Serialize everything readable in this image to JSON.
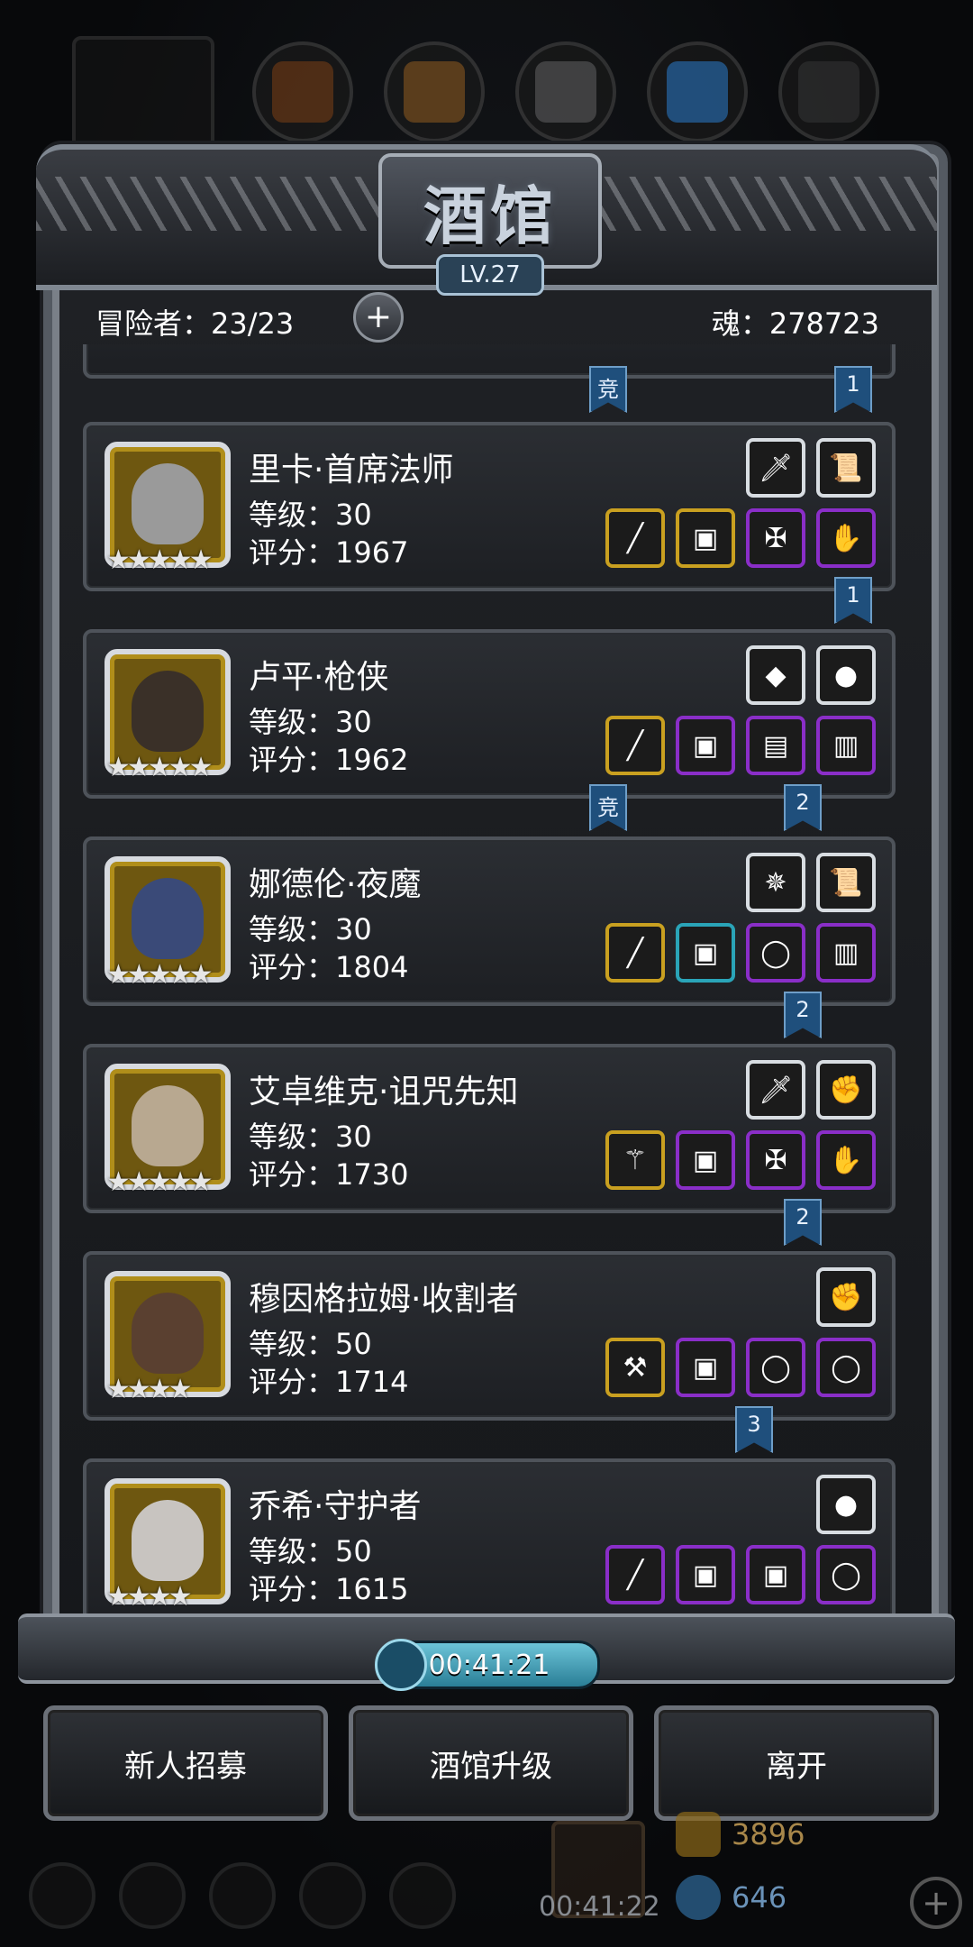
{
  "panel": {
    "title": "酒馆",
    "level": "LV.27",
    "adventurers_label": "冒险者：23/23",
    "soul_label": "魂：278723"
  },
  "top_ribbons": [
    {
      "label": "竞"
    },
    {
      "label": "1"
    }
  ],
  "heroes": [
    {
      "name": "里卡·首席法师",
      "level": "等级：30",
      "score": "评分：1967",
      "stars": "★★★★★",
      "portrait_color": "#9a9a9a",
      "top_items": [
        {
          "icon": "dagger-icon",
          "glyph": "🗡",
          "rarity": "white"
        },
        {
          "icon": "scroll-icon",
          "glyph": "📜",
          "rarity": "white"
        }
      ],
      "bottom_items": [
        {
          "icon": "staff-icon",
          "glyph": "╱",
          "rarity": "gold"
        },
        {
          "icon": "armor-icon",
          "glyph": "▣",
          "rarity": "gold"
        },
        {
          "icon": "amulet-icon",
          "glyph": "✠",
          "rarity": "purple"
        },
        {
          "icon": "gauntlet-icon",
          "glyph": "✋",
          "rarity": "purple"
        }
      ],
      "ribbons": [
        {
          "label": "1"
        }
      ]
    },
    {
      "name": "卢平·枪侠",
      "level": "等级：30",
      "score": "评分：1962",
      "stars": "★★★★★",
      "portrait_color": "#3a3028",
      "top_items": [
        {
          "icon": "crystal-icon",
          "glyph": "◆",
          "rarity": "white"
        },
        {
          "icon": "gem-icon",
          "glyph": "●",
          "rarity": "white"
        }
      ],
      "bottom_items": [
        {
          "icon": "spear-icon",
          "glyph": "╱",
          "rarity": "gold"
        },
        {
          "icon": "armor-icon",
          "glyph": "▣",
          "rarity": "purple"
        },
        {
          "icon": "plank-icon",
          "glyph": "▤",
          "rarity": "purple"
        },
        {
          "icon": "cloak-icon",
          "glyph": "▥",
          "rarity": "purple"
        }
      ],
      "ribbons": [
        {
          "label": "竞"
        },
        {
          "label": "2"
        }
      ]
    },
    {
      "name": "娜德伦·夜魔",
      "level": "等级：30",
      "score": "评分：1804",
      "stars": "★★★★★",
      "portrait_color": "#3a4a78",
      "top_items": [
        {
          "icon": "emblem-icon",
          "glyph": "✵",
          "rarity": "white"
        },
        {
          "icon": "scroll-icon",
          "glyph": "📜",
          "rarity": "white"
        }
      ],
      "bottom_items": [
        {
          "icon": "spear-icon",
          "glyph": "╱",
          "rarity": "gold"
        },
        {
          "icon": "armor-icon",
          "glyph": "▣",
          "rarity": "cyan"
        },
        {
          "icon": "ring-icon",
          "glyph": "◯",
          "rarity": "purple"
        },
        {
          "icon": "cloak-icon",
          "glyph": "▥",
          "rarity": "purple"
        }
      ],
      "ribbons": [
        {
          "label": "2"
        }
      ]
    },
    {
      "name": "艾卓维克·诅咒先知",
      "level": "等级：30",
      "score": "评分：1730",
      "stars": "★★★★★",
      "portrait_color": "#b8a890",
      "top_items": [
        {
          "icon": "dagger-icon",
          "glyph": "🗡",
          "rarity": "white"
        },
        {
          "icon": "glove-icon",
          "glyph": "✊",
          "rarity": "white"
        }
      ],
      "bottom_items": [
        {
          "icon": "staff-icon",
          "glyph": "⚚",
          "rarity": "gold"
        },
        {
          "icon": "armor-icon",
          "glyph": "▣",
          "rarity": "purple"
        },
        {
          "icon": "amulet-icon",
          "glyph": "✠",
          "rarity": "purple"
        },
        {
          "icon": "gauntlet-icon",
          "glyph": "✋",
          "rarity": "purple"
        }
      ],
      "ribbons": [
        {
          "label": "2"
        }
      ]
    },
    {
      "name": "穆因格拉姆·收割者",
      "level": "等级：50",
      "score": "评分：1714",
      "stars": "★★★★",
      "portrait_color": "#5a4030",
      "top_items": [
        {
          "icon": "glove-icon",
          "glyph": "✊",
          "rarity": "white"
        }
      ],
      "bottom_items": [
        {
          "icon": "axe-icon",
          "glyph": "⚒",
          "rarity": "gold"
        },
        {
          "icon": "armor-icon",
          "glyph": "▣",
          "rarity": "purple"
        },
        {
          "icon": "ring-icon",
          "glyph": "◯",
          "rarity": "purple"
        },
        {
          "icon": "ring-icon",
          "glyph": "◯",
          "rarity": "purple"
        }
      ],
      "ribbons": [
        {
          "label": "3"
        }
      ]
    },
    {
      "name": "乔希·守护者",
      "level": "等级：50",
      "score": "评分：1615",
      "stars": "★★★★",
      "portrait_color": "#c8c4c0",
      "top_items": [
        {
          "icon": "gem-icon",
          "glyph": "●",
          "rarity": "white"
        }
      ],
      "bottom_items": [
        {
          "icon": "sword-icon",
          "glyph": "╱",
          "rarity": "purple"
        },
        {
          "icon": "armor-icon",
          "glyph": "▣",
          "rarity": "purple"
        },
        {
          "icon": "armor-icon",
          "glyph": "▣",
          "rarity": "purple"
        },
        {
          "icon": "ring-icon",
          "glyph": "◯",
          "rarity": "purple"
        }
      ],
      "ribbons": []
    }
  ],
  "timer": "00:41:21",
  "buttons": {
    "recruit": "新人招募",
    "upgrade": "酒馆升级",
    "leave": "离开"
  },
  "background_hud": {
    "gift_timer": "00:41:22",
    "gold": "3896",
    "gems": "646"
  }
}
